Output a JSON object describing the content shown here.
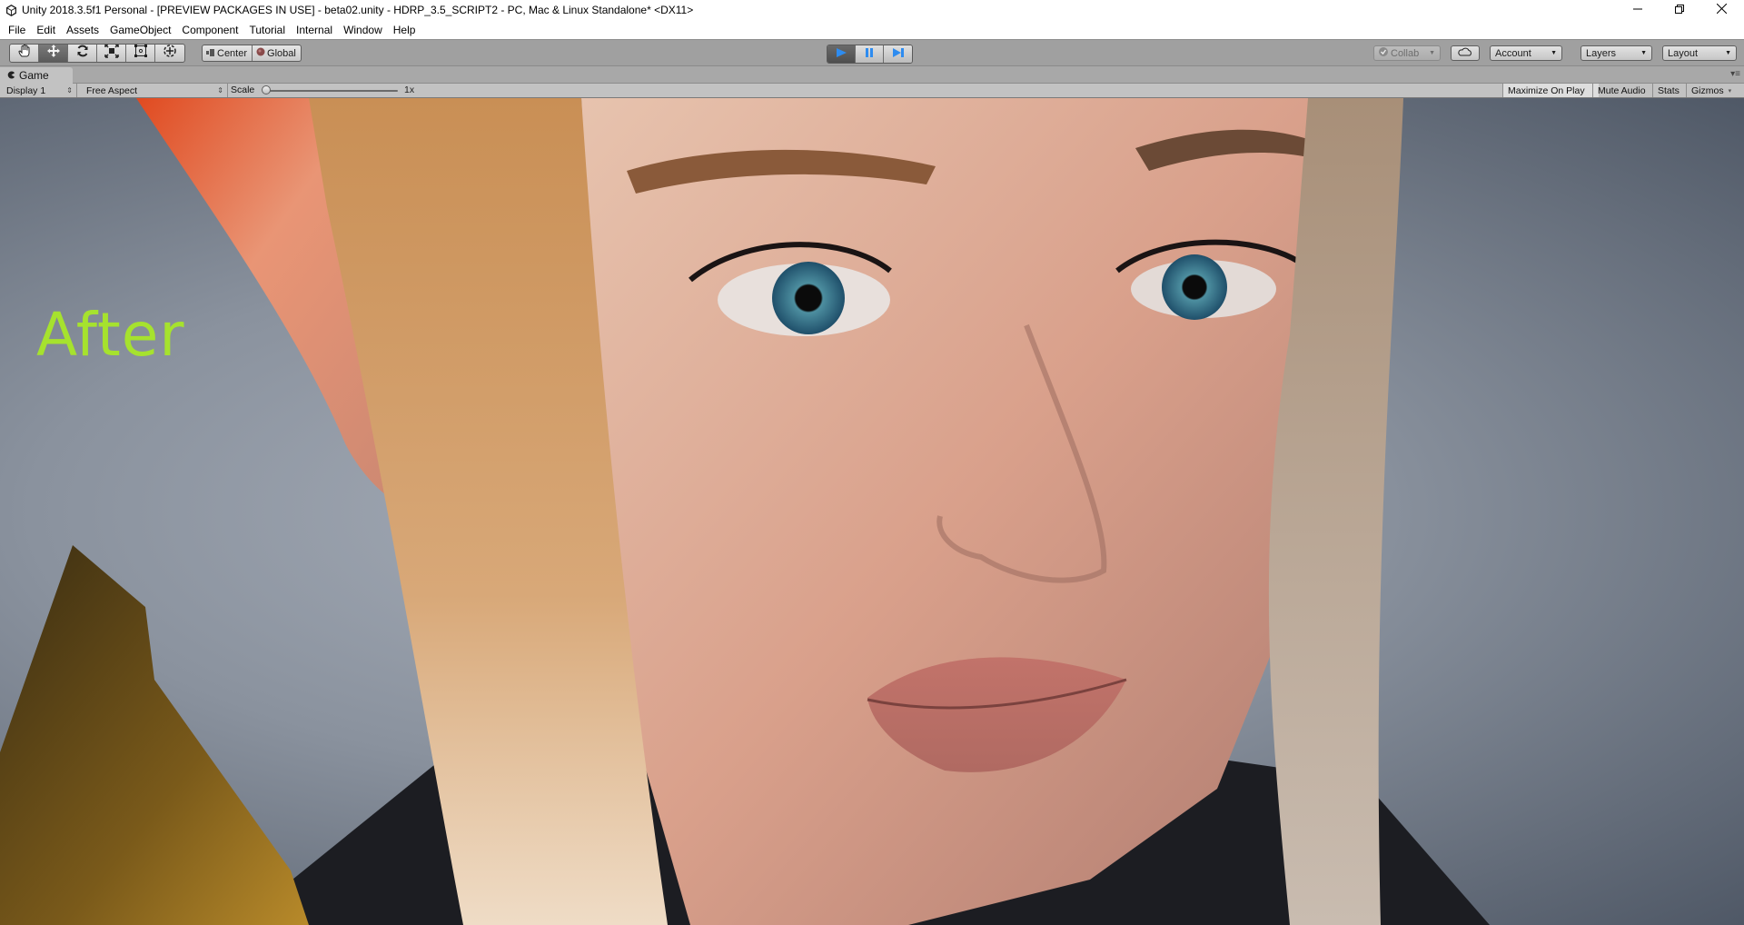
{
  "window": {
    "title": "Unity 2018.3.5f1 Personal - [PREVIEW PACKAGES IN USE] - beta02.unity - HDRP_3.5_SCRIPT2 - PC, Mac & Linux Standalone* <DX11>",
    "app_icon": "unity-logo-icon",
    "controls": {
      "minimize": "minimize-icon",
      "maximize": "restore-icon",
      "close": "close-icon"
    }
  },
  "menubar": {
    "items": [
      {
        "label": "File"
      },
      {
        "label": "Edit"
      },
      {
        "label": "Assets"
      },
      {
        "label": "GameObject"
      },
      {
        "label": "Component"
      },
      {
        "label": "Tutorial"
      },
      {
        "label": "Internal"
      },
      {
        "label": "Window"
      },
      {
        "label": "Help"
      }
    ]
  },
  "toolbar": {
    "transform_tools": [
      {
        "icon": "hand-icon",
        "active": false
      },
      {
        "icon": "move-icon",
        "active": true
      },
      {
        "icon": "rotate-icon",
        "active": false
      },
      {
        "icon": "scale-icon",
        "active": false
      },
      {
        "icon": "rect-tool-icon",
        "active": false
      },
      {
        "icon": "transform-tool-icon",
        "active": false
      }
    ],
    "pivot_mode": "Center",
    "pivot_rotation": "Global",
    "play": {
      "play_active": true,
      "pause_active": false
    },
    "collab_label": "Collab",
    "account_label": "Account",
    "layers_label": "Layers",
    "layout_label": "Layout"
  },
  "game_tab": {
    "label": "Game",
    "icon": "game-pacman-icon"
  },
  "game_toolbar": {
    "display": "Display 1",
    "aspect": "Free Aspect",
    "scale_label": "Scale",
    "scale_value": "1x",
    "scale_fraction": 0.0,
    "maximize_on_play": "Maximize On Play",
    "maximize_on_play_active": true,
    "mute_audio": "Mute Audio",
    "stats": "Stats",
    "gizmos": "Gizmos"
  },
  "viewport": {
    "overlay_text": "After",
    "overlay_color": "#a6e22e",
    "scene_description": "Close-up HDRP render of an elf character face with blonde hair, blue eyes, pointed ear and gold armor"
  }
}
